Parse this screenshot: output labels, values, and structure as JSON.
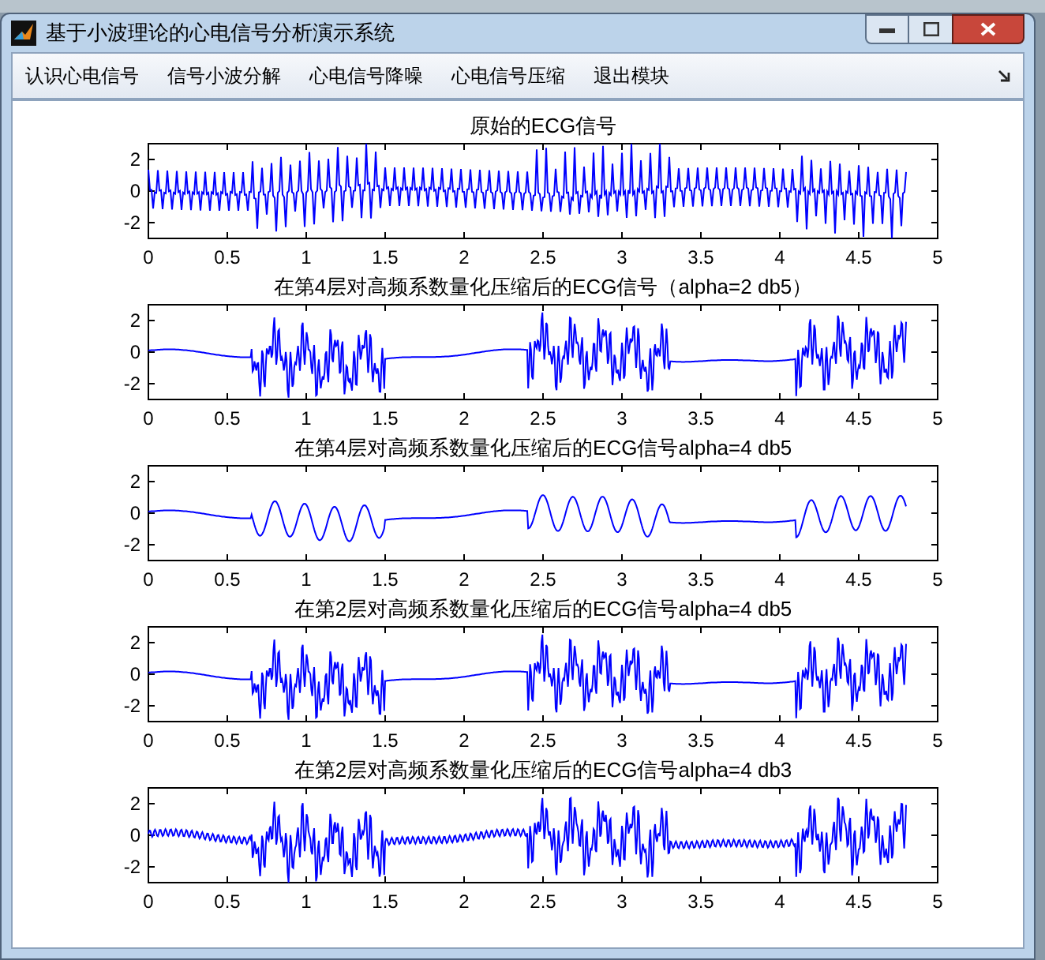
{
  "window": {
    "title": "基于小波理论的心电信号分析演示系统"
  },
  "menu": [
    "认识心电信号",
    "信号小波分解",
    "心电信号降噪",
    "心电信号压缩",
    "退出模块"
  ],
  "plots": [
    {
      "title": "原始的ECG信号",
      "kind": "dense",
      "xticks": [
        "0",
        "0.5",
        "1",
        "1.5",
        "2",
        "2.5",
        "3",
        "3.5",
        "4",
        "4.5",
        "5"
      ],
      "yticks": [
        "2",
        "0",
        "-2"
      ]
    },
    {
      "title": "在第4层对高频系数量化压缩后的ECG信号（alpha=2 db5）",
      "kind": "spiky",
      "xticks": [
        "0",
        "0.5",
        "1",
        "1.5",
        "2",
        "2.5",
        "3",
        "3.5",
        "4",
        "4.5",
        "5"
      ],
      "yticks": [
        "2",
        "0",
        "-2"
      ]
    },
    {
      "title": "在第4层对高频系数量化压缩后的ECG信号alpha=4 db5",
      "kind": "smooth",
      "xticks": [
        "0",
        "0.5",
        "1",
        "1.5",
        "2",
        "2.5",
        "3",
        "3.5",
        "4",
        "4.5",
        "5"
      ],
      "yticks": [
        "2",
        "0",
        "-2"
      ]
    },
    {
      "title": "在第2层对高频系数量化压缩后的ECG信号alpha=4 db5",
      "kind": "spiky",
      "xticks": [
        "0",
        "0.5",
        "1",
        "1.5",
        "2",
        "2.5",
        "3",
        "3.5",
        "4",
        "4.5",
        "5"
      ],
      "yticks": [
        "2",
        "0",
        "-2"
      ]
    },
    {
      "title": "在第2层对高频系数量化压缩后的ECG信号alpha=4 db3",
      "kind": "noisy",
      "xticks": [
        "0",
        "0.5",
        "1",
        "1.5",
        "2",
        "2.5",
        "3",
        "3.5",
        "4",
        "4.5",
        "5"
      ],
      "yticks": [
        "2",
        "0",
        "-2"
      ]
    }
  ]
}
